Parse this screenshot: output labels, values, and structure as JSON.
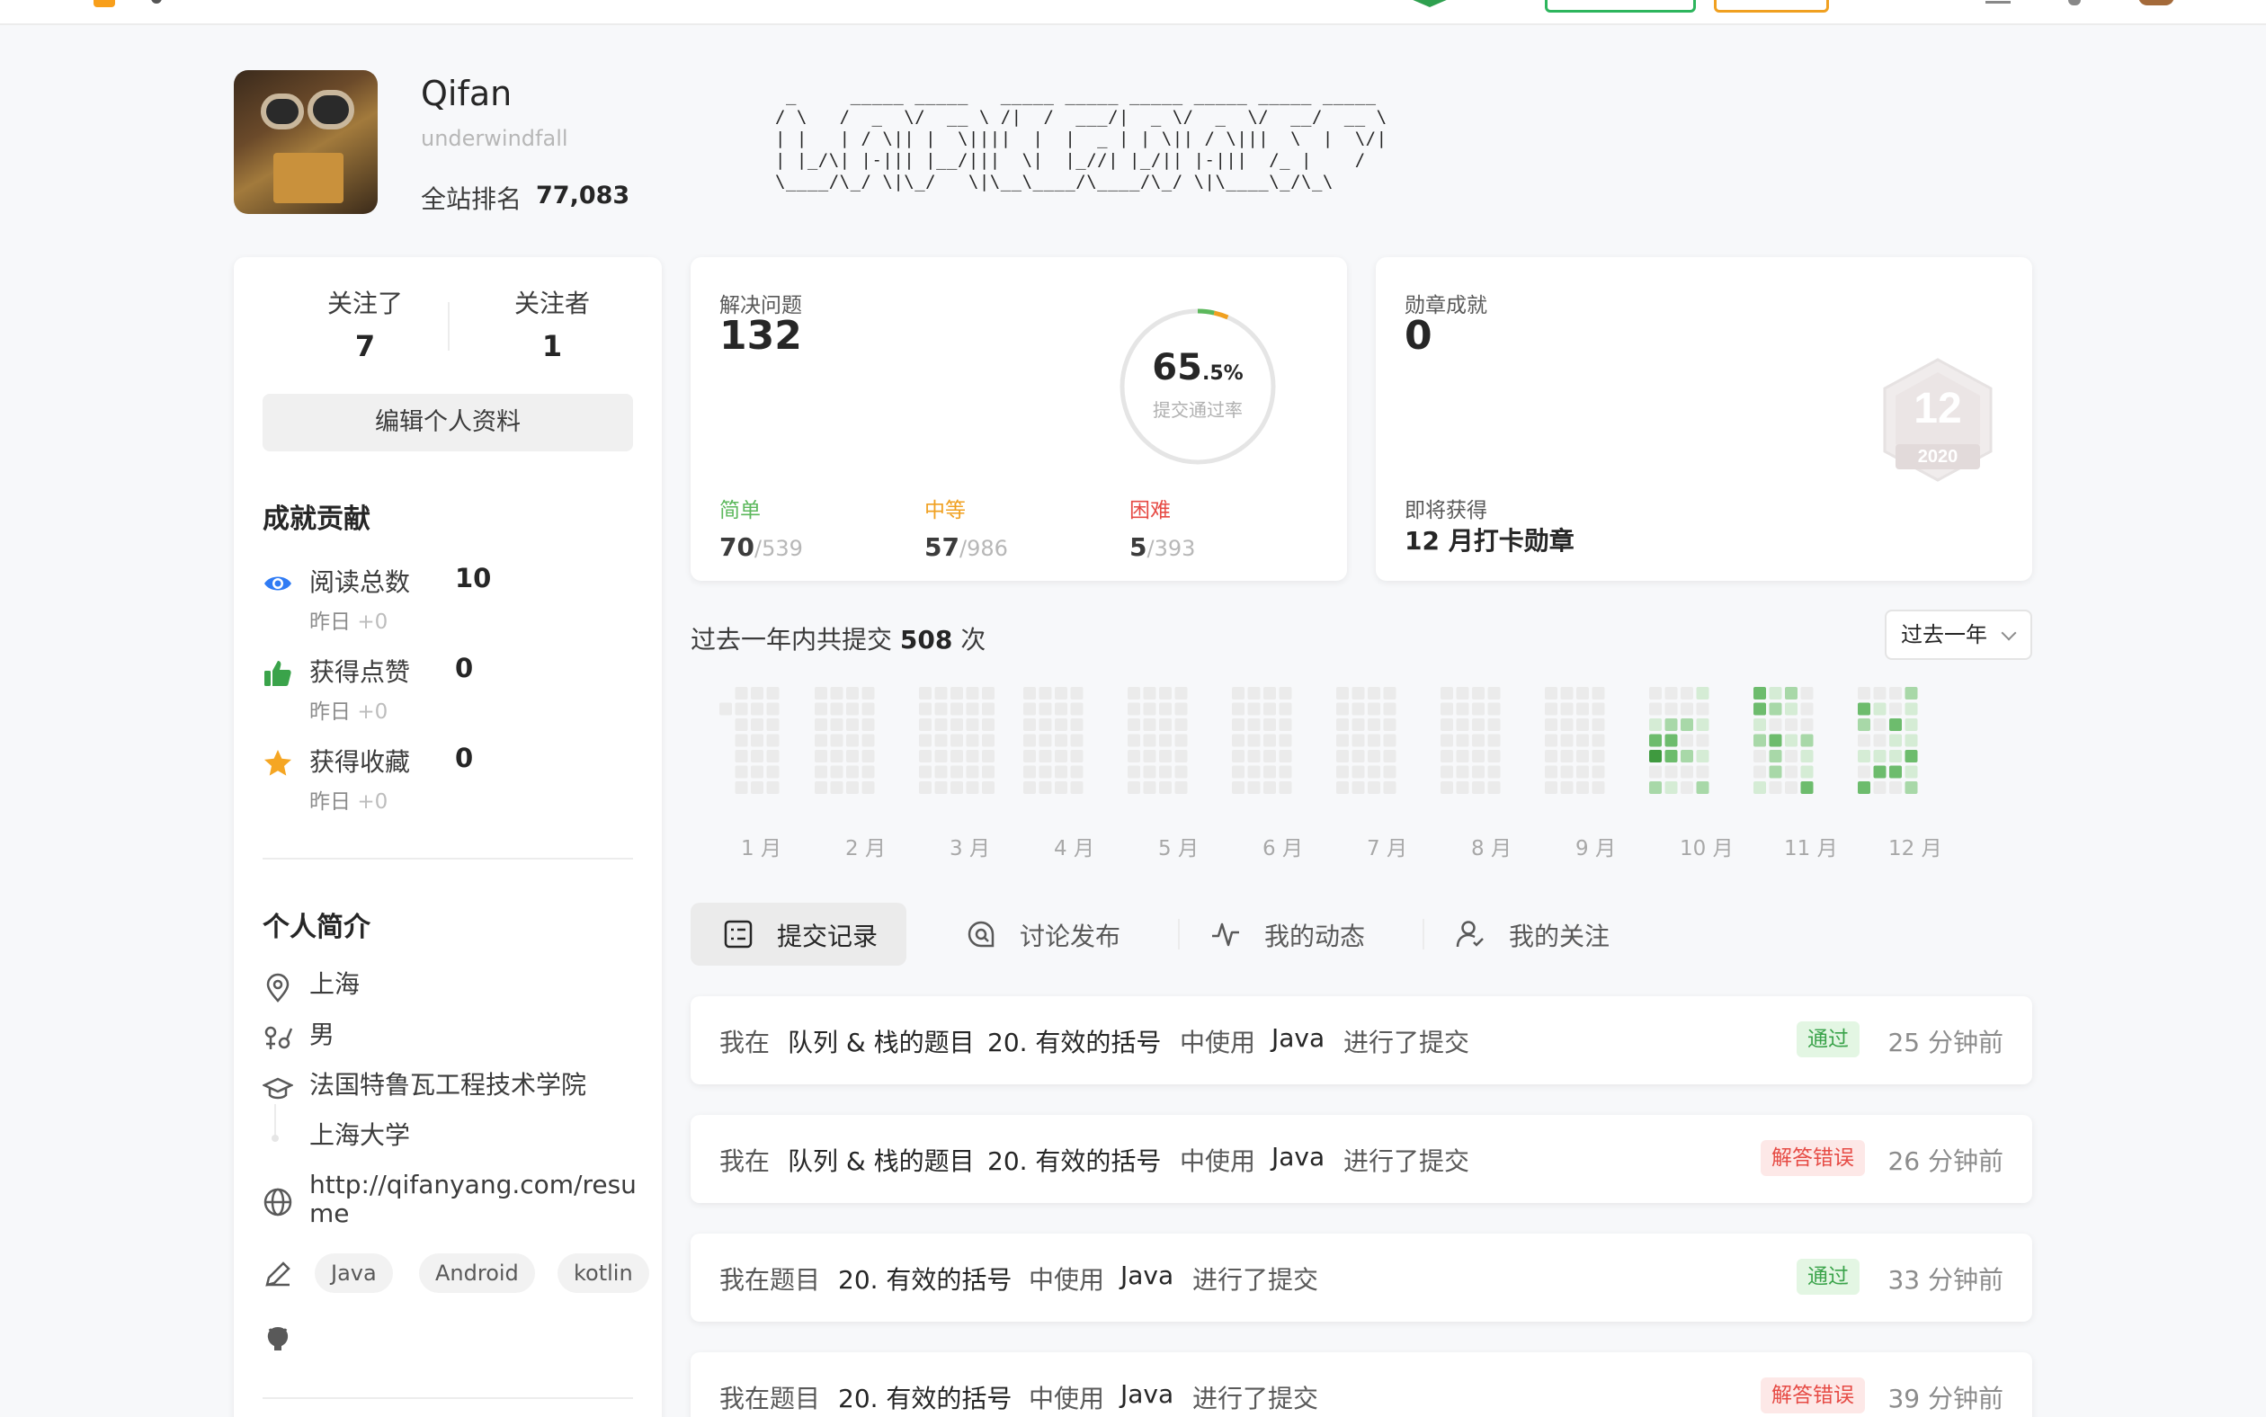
{
  "profile": {
    "name": "Qifan",
    "username": "underwindfall",
    "rank_label": "全站排名",
    "rank_value": "77,083",
    "ascii_lines": [
      " _     _____ _____   _____ _____ _____ _____ _____ _____ ",
      "/ \\   /  _  \\/  __ \\ /|  /  ___/|  _ \\/  _  \\/  __/  __ \\",
      "| |   | / \\|| |  \\||||  |  |  _ | | \\|| / \\|||  \\  |  \\/|",
      "| |_/\\| |-||| |__/|||  \\|  |_//| |_/|| |-|||  /_ |    /",
      "\\____/\\_/ \\|\\_/   \\|\\__\\____/\\____/\\_/ \\|\\____\\_/\\_\\"
    ]
  },
  "follow": {
    "following_label": "关注了",
    "following_count": "7",
    "followers_label": "关注者",
    "followers_count": "1",
    "edit_label": "编辑个人资料"
  },
  "achievements": {
    "title": "成就贡献",
    "items": [
      {
        "label": "阅读总数",
        "value": "10",
        "yesterday": "昨日",
        "delta": "+0"
      },
      {
        "label": "获得点赞",
        "value": "0",
        "yesterday": "昨日",
        "delta": "+0"
      },
      {
        "label": "获得收藏",
        "value": "0",
        "yesterday": "昨日",
        "delta": "+0"
      }
    ]
  },
  "bio": {
    "title": "个人简介",
    "location": "上海",
    "gender": "男",
    "school1": "法国特鲁瓦工程技术学院",
    "school2": "上海大学",
    "website": "http://qifanyang.com/resume",
    "skills": [
      "Java",
      "Android",
      "kotlin"
    ]
  },
  "solved": {
    "title": "解决问题",
    "count": "132",
    "rate_int": "65",
    "rate_dec": ".5%",
    "rate_label": "提交通过率",
    "easy_label": "简单",
    "easy_done": "70",
    "easy_total": "539",
    "medium_label": "中等",
    "medium_done": "57",
    "medium_total": "986",
    "hard_label": "困难",
    "hard_done": "5",
    "hard_total": "393",
    "colors": {
      "easy": "#5cb85c",
      "medium": "#f0a020",
      "hard": "#e64b45"
    }
  },
  "badges": {
    "title": "勋章成就",
    "count": "0",
    "soon_label": "即将获得",
    "soon_name": "12 月打卡勋章",
    "badge_number": "12",
    "badge_year": "2020"
  },
  "submissions": {
    "prefix": "过去一年内共提交",
    "count": "508",
    "suffix": "次",
    "range": "过去一年",
    "months": [
      "1 月",
      "2 月",
      "3 月",
      "4 月",
      "5 月",
      "6 月",
      "7 月",
      "8 月",
      "9 月",
      "10 月",
      "11 月",
      "12 月"
    ]
  },
  "tabs": [
    {
      "label": "提交记录",
      "icon": "checklist-icon"
    },
    {
      "label": "讨论发布",
      "icon": "discussion-icon"
    },
    {
      "label": "我的动态",
      "icon": "activity-icon"
    },
    {
      "label": "我的关注",
      "icon": "user-follow-icon"
    }
  ],
  "records": [
    {
      "pre": "我在",
      "topic": "队列 & 栈的题目",
      "problem": "20. 有效的括号",
      "mid": "中使用",
      "lang": "Java",
      "post": "进行了提交",
      "status": "通过",
      "time": "25 分钟前"
    },
    {
      "pre": "我在",
      "topic": "队列 & 栈的题目",
      "problem": "20. 有效的括号",
      "mid": "中使用",
      "lang": "Java",
      "post": "进行了提交",
      "status": "解答错误",
      "time": "26 分钟前"
    },
    {
      "pre": "我在题目",
      "topic": "",
      "problem": "20. 有效的括号",
      "mid": "中使用",
      "lang": "Java",
      "post": "进行了提交",
      "status": "通过",
      "time": "33 分钟前"
    },
    {
      "pre": "我在题目",
      "topic": "",
      "problem": "20. 有效的括号",
      "mid": "中使用",
      "lang": "Java",
      "post": "进行了提交",
      "status": "解答错误",
      "time": "39 分钟前"
    }
  ]
}
